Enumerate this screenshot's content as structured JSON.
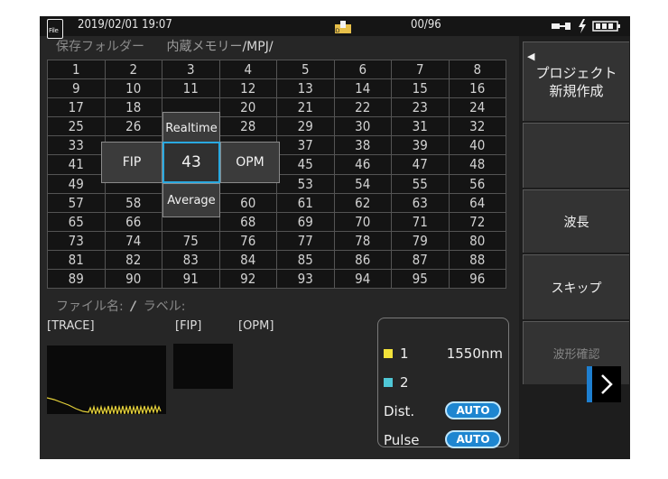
{
  "status_bar": {
    "file_icon_text": "File",
    "datetime": "2019/02/01  19:07",
    "counter": "00/96"
  },
  "folder_bar": {
    "label": "保存フォルダー",
    "location": "内蔵メモリー",
    "folder": "/MPJ/"
  },
  "grid": {
    "rows": [
      [
        "1",
        "2",
        "3",
        "4",
        "5",
        "6",
        "7",
        "8"
      ],
      [
        "9",
        "10",
        "11",
        "12",
        "13",
        "14",
        "15",
        "16"
      ],
      [
        "17",
        "18",
        "",
        "20",
        "21",
        "22",
        "23",
        "24"
      ],
      [
        "25",
        "26",
        "",
        "28",
        "29",
        "30",
        "31",
        "32"
      ],
      [
        "33",
        "",
        "",
        "",
        "37",
        "38",
        "39",
        "40"
      ],
      [
        "41",
        "",
        "",
        "",
        "45",
        "46",
        "47",
        "48"
      ],
      [
        "49",
        "",
        "",
        "",
        "53",
        "54",
        "55",
        "56"
      ],
      [
        "57",
        "58",
        "",
        "60",
        "61",
        "62",
        "63",
        "64"
      ],
      [
        "65",
        "66",
        "",
        "68",
        "69",
        "70",
        "71",
        "72"
      ],
      [
        "73",
        "74",
        "75",
        "76",
        "77",
        "78",
        "79",
        "80"
      ],
      [
        "81",
        "82",
        "83",
        "84",
        "85",
        "86",
        "87",
        "88"
      ],
      [
        "89",
        "90",
        "91",
        "92",
        "93",
        "94",
        "95",
        "96"
      ]
    ]
  },
  "navigator": {
    "up": "Realtime",
    "left": "FIP",
    "center": "43",
    "right": "OPM",
    "down": "Average"
  },
  "file_label_row": {
    "filename": "ファイル名",
    "separator": "/",
    "label": "ラベル"
  },
  "results": {
    "trace_label": "[TRACE]",
    "fip_label": "[FIP]",
    "opm_label": "[OPM]"
  },
  "info_panel": {
    "wavelength1_index": "1",
    "wavelength1_value": "1550nm",
    "wavelength2_index": "2",
    "dist_label": "Dist.",
    "dist_value": "AUTO",
    "pulse_label": "Pulse",
    "pulse_value": "AUTO",
    "colors": {
      "wavelength1": "#f2e23a",
      "wavelength2": "#4fc7d6",
      "auto_pill": "#1e86d0"
    }
  },
  "side_menu": {
    "project_line1": "プロジェクト",
    "project_line2": "新規作成",
    "wavelength": "波長",
    "skip": "スキップ",
    "waveform_check": "波形確認"
  },
  "icons": [
    "file-icon",
    "save-folder-icon",
    "connection-icon",
    "lightning-icon",
    "battery-icon",
    "chevron-right-icon",
    "back-arrow-icon"
  ]
}
